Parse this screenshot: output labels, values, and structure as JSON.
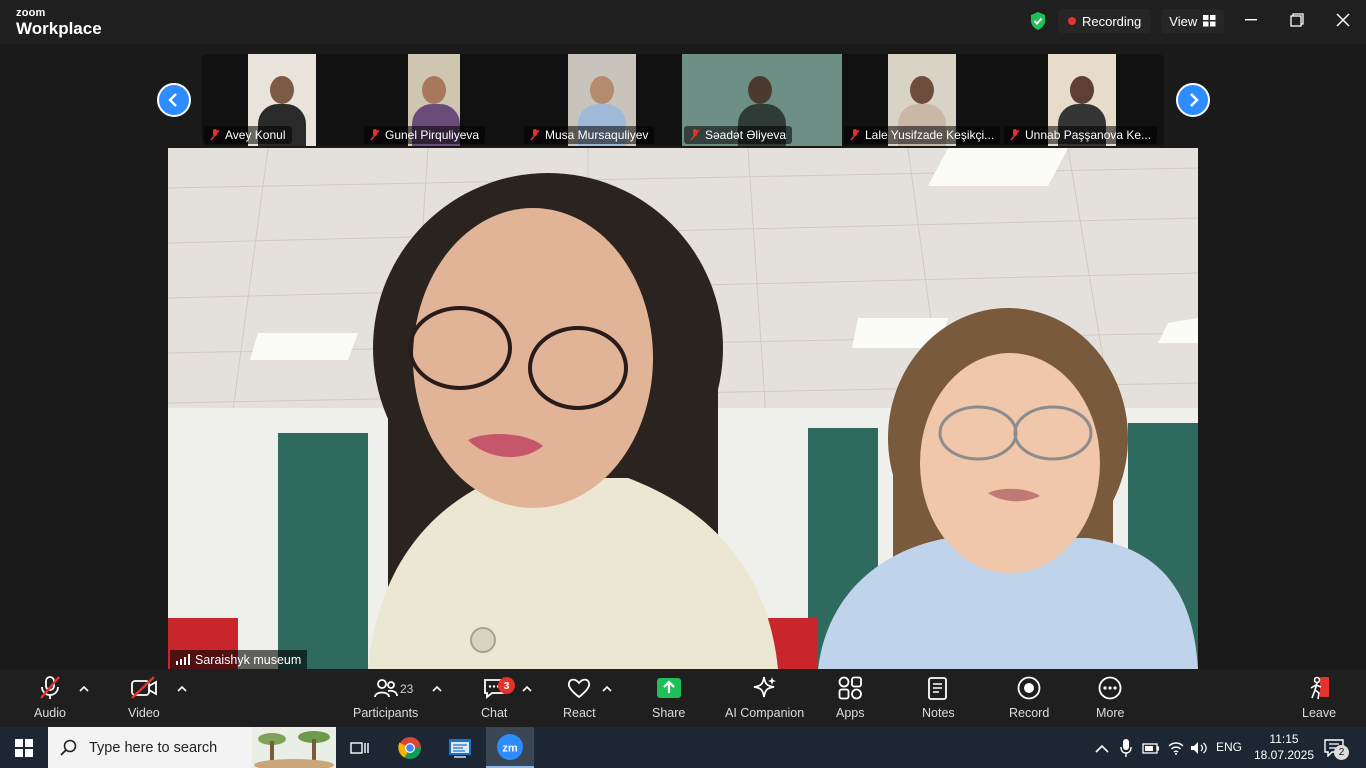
{
  "app": {
    "brand_small": "zoom",
    "brand_big": "Workplace"
  },
  "titlebar": {
    "recording_label": "Recording",
    "view_label": "View"
  },
  "gallery": {
    "participants": [
      {
        "name": "Avey Konul"
      },
      {
        "name": "Gunel Pirquliyeva"
      },
      {
        "name": "Musa Mursaquliyev"
      },
      {
        "name": "Səadət Əliyeva"
      },
      {
        "name": "Lale Yusifzade Keşikçi..."
      },
      {
        "name": "Unnab Paşşanova  Ke..."
      }
    ]
  },
  "main_video": {
    "speaker_name": "Saraishyk museum"
  },
  "toolbar": {
    "audio": "Audio",
    "video": "Video",
    "participants": "Participants",
    "participants_count": "23",
    "chat": "Chat",
    "chat_badge": "3",
    "react": "React",
    "share": "Share",
    "ai_companion": "AI Companion",
    "apps": "Apps",
    "notes": "Notes",
    "record": "Record",
    "more": "More",
    "leave": "Leave"
  },
  "taskbar": {
    "search_placeholder": "Type here to search",
    "language": "ENG",
    "time": "11:15",
    "date": "18.07.2025",
    "notification_count": "2"
  },
  "colors": {
    "accent": "#2d8cff",
    "record_red": "#e5322d",
    "share_green": "#1fbf5a"
  }
}
